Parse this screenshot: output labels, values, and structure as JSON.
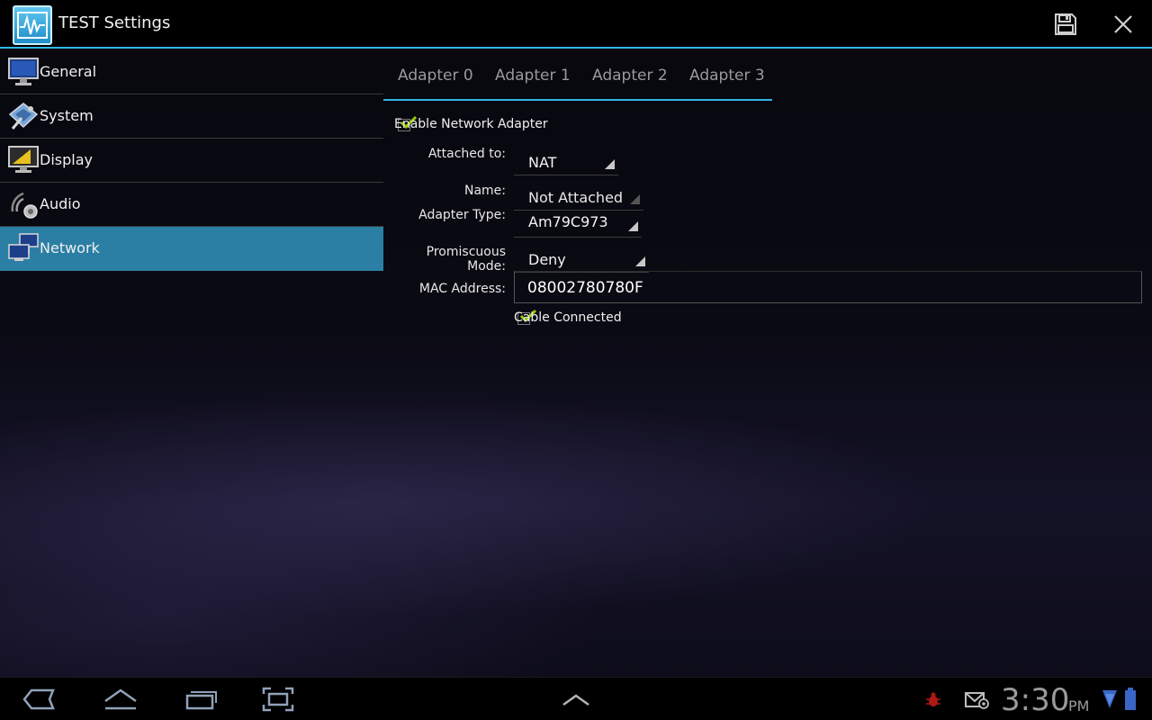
{
  "app": {
    "title": "TEST Settings",
    "icon": "waveform-app-icon"
  },
  "actions": {
    "save_icon": "floppy-disk-icon",
    "close_icon": "close-x-icon"
  },
  "sidebar": {
    "items": [
      {
        "label": "General",
        "icon": "monitor-icon"
      },
      {
        "label": "System",
        "icon": "chip-wrench-icon"
      },
      {
        "label": "Display",
        "icon": "display-ruler-icon"
      },
      {
        "label": "Audio",
        "icon": "speaker-icon"
      },
      {
        "label": "Network",
        "icon": "networked-computers-icon",
        "active": true
      }
    ]
  },
  "tabs": [
    "Adapter 0",
    "Adapter 1",
    "Adapter 2",
    "Adapter 3"
  ],
  "form": {
    "enable_label": "Enable Network Adapter",
    "enable_checked": true,
    "attached_label": "Attached to:",
    "attached_value": "NAT",
    "name_label": "Name:",
    "name_value": "Not Attached",
    "adapter_type_label": "Adapter Type:",
    "adapter_type_value": "Am79C973",
    "promiscuous_label": "Promiscuous Mode:",
    "promiscuous_value": "Deny",
    "mac_label": "MAC Address:",
    "mac_value": "08002780780F",
    "cable_label": "Cable Connected",
    "cable_checked": true
  },
  "systembar": {
    "time": "3:30",
    "ampm": "PM",
    "icons": [
      "back-icon",
      "home-icon",
      "recent-apps-icon",
      "screenshot-icon",
      "up-caret-icon",
      "bug-icon",
      "mail-icon",
      "wifi-icon",
      "battery-icon"
    ]
  },
  "colors": {
    "accent": "#33b5e5",
    "active_item": "#2b7fa4",
    "check": "#99cc00"
  }
}
